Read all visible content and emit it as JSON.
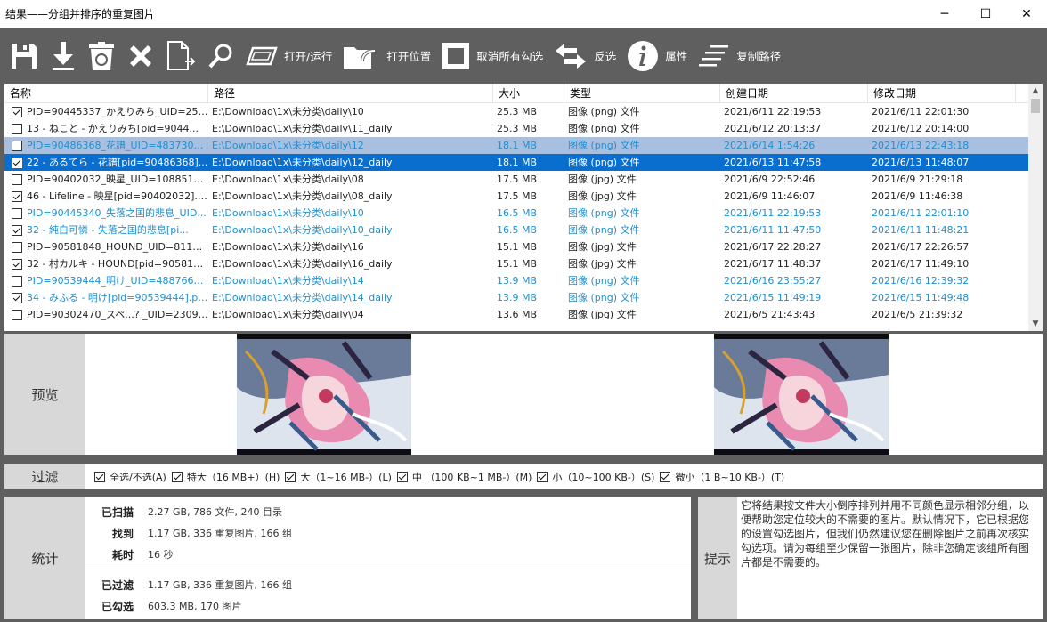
{
  "window": {
    "title": "结果——分组并排序的重复图片",
    "minimize": "─",
    "maximize": "☐",
    "close": "✕"
  },
  "toolbar": {
    "open_run_label": "打开/运行",
    "open_location_label": "打开位置",
    "uncheck_all_label": "取消所有勾选",
    "invert_label": "反选",
    "properties_label": "属性",
    "copy_path_label": "复制路径"
  },
  "table": {
    "headers": [
      "名称",
      "路径",
      "大小",
      "类型",
      "创建日期",
      "修改日期"
    ],
    "rows": [
      {
        "checked": true,
        "style": "normal",
        "name": "PID=90445337_かえりみち_UID=256...",
        "path": "E:\\Download\\1x\\未分类\\daily\\10",
        "size": "25.3 MB",
        "type": "图像 (png) 文件",
        "created": "2021/6/11 22:19:53",
        "modified": "2021/6/11 22:01:30"
      },
      {
        "checked": false,
        "style": "normal",
        "name": "13 - ねこと - かえりみち[pid=9044...",
        "path": "E:\\Download\\1x\\未分类\\daily\\11_daily",
        "size": "25.3 MB",
        "type": "图像 (png) 文件",
        "created": "2021/6/12 20:13:37",
        "modified": "2021/6/12 20:14:00"
      },
      {
        "checked": false,
        "style": "blue hl",
        "name": "PID=90486368_花譜_UID=483730_p0...",
        "path": "E:\\Download\\1x\\未分类\\daily\\12",
        "size": "18.1 MB",
        "type": "图像 (png) 文件",
        "created": "2021/6/14 1:54:26",
        "modified": "2021/6/13 22:43:18"
      },
      {
        "checked": true,
        "style": "sel",
        "name": "22 - あるてら - 花譜[pid=90486368]...",
        "path": "E:\\Download\\1x\\未分类\\daily\\12_daily",
        "size": "18.1 MB",
        "type": "图像 (png) 文件",
        "created": "2021/6/13 11:47:58",
        "modified": "2021/6/13 11:48:07"
      },
      {
        "checked": false,
        "style": "normal",
        "name": "PID=90402032_映星_UID=10885193_...",
        "path": "E:\\Download\\1x\\未分类\\daily\\08",
        "size": "17.5 MB",
        "type": "图像 (jpg) 文件",
        "created": "2021/6/9 22:52:46",
        "modified": "2021/6/9 21:29:18"
      },
      {
        "checked": true,
        "style": "normal",
        "name": "46 - Lifeline - 映星[pid=90402032].jpg",
        "path": "E:\\Download\\1x\\未分类\\daily\\08_daily",
        "size": "17.5 MB",
        "type": "图像 (jpg) 文件",
        "created": "2021/6/9 11:46:07",
        "modified": "2021/6/9 11:46:38"
      },
      {
        "checked": false,
        "style": "blue",
        "name": "PID=90445340_失落之国的悲息_UID...",
        "path": "E:\\Download\\1x\\未分类\\daily\\10",
        "size": "16.5 MB",
        "type": "图像 (png) 文件",
        "created": "2021/6/11 22:19:53",
        "modified": "2021/6/11 22:01:10"
      },
      {
        "checked": true,
        "style": "blue",
        "name": "32 - 純白可憐 - 失落之国的悲息[pi...",
        "path": "E:\\Download\\1x\\未分类\\daily\\10_daily",
        "size": "16.5 MB",
        "type": "图像 (png) 文件",
        "created": "2021/6/11 11:47:50",
        "modified": "2021/6/11 11:48:21"
      },
      {
        "checked": false,
        "style": "normal",
        "name": "PID=90581848_HOUND_UID=811927_...",
        "path": "E:\\Download\\1x\\未分类\\daily\\16",
        "size": "15.1 MB",
        "type": "图像 (jpg) 文件",
        "created": "2021/6/17 22:28:27",
        "modified": "2021/6/17 22:26:57"
      },
      {
        "checked": true,
        "style": "normal",
        "name": "32 - 村カルキ - HOUND[pid=905818...",
        "path": "E:\\Download\\1x\\未分类\\daily\\16_daily",
        "size": "15.1 MB",
        "type": "图像 (jpg) 文件",
        "created": "2021/6/17 11:48:37",
        "modified": "2021/6/17 11:49:10"
      },
      {
        "checked": false,
        "style": "blue",
        "name": "PID=90539444_明け_UID=488766_p0...",
        "path": "E:\\Download\\1x\\未分类\\daily\\14",
        "size": "13.9 MB",
        "type": "图像 (png) 文件",
        "created": "2021/6/16 23:55:27",
        "modified": "2021/6/16 12:39:32"
      },
      {
        "checked": true,
        "style": "blue",
        "name": "34 - みふる - 明け[pid=90539444].png",
        "path": "E:\\Download\\1x\\未分类\\daily\\14_daily",
        "size": "13.9 MB",
        "type": "图像 (png) 文件",
        "created": "2021/6/15 11:49:19",
        "modified": "2021/6/15 11:49:48"
      },
      {
        "checked": false,
        "style": "normal",
        "name": "PID=90302470_スペ...? _UID=230984...",
        "path": "E:\\Download\\1x\\未分类\\daily\\04",
        "size": "13.6 MB",
        "type": "图像 (jpg) 文件",
        "created": "2021/6/5 21:43:43",
        "modified": "2021/6/5 21:39:32"
      }
    ]
  },
  "preview": {
    "label": "预览"
  },
  "filter": {
    "label": "过滤",
    "options": [
      {
        "checked": true,
        "text": "全选/不选(A)"
      },
      {
        "checked": true,
        "text": "特大（16 MB+）(H)"
      },
      {
        "checked": true,
        "text": "大（1~16 MB-）(L)"
      },
      {
        "checked": true,
        "text": "中 （100 KB~1 MB-）(M)"
      },
      {
        "checked": true,
        "text": "小（10~100 KB-）(S)"
      },
      {
        "checked": true,
        "text": "微小（1 B~10 KB-）(T)"
      }
    ]
  },
  "stats": {
    "label": "统计",
    "scanned_key": "已扫描",
    "scanned_val": "2.27 GB, 786 文件, 240 目录",
    "found_key": "找到",
    "found_val": "1.17 GB, 336 重复图片, 166 组",
    "elapsed_key": "耗时",
    "elapsed_val": "16 秒",
    "filtered_key": "已过滤",
    "filtered_val": "1.17 GB, 336 重复图片, 166 组",
    "checked_key": "已勾选",
    "checked_val": "603.3 MB, 170 图片"
  },
  "tip": {
    "label": "提示",
    "text": "它将结果按文件大小倒序排列并用不同颜色显示相邻分组，以便帮助您定位较大的不需要的图片。默认情况下，它已根据您的设置勾选图片，但我们仍然建议您在删除图片之前再次核实勾选项。请为每组至少保留一张图片，除非您确定该组所有图片都是不需要的。"
  },
  "colors": {
    "toolbar_bg": "#5f5f5f",
    "selected_row": "#0a6ecf",
    "highlight_row": "#a8bfe0",
    "group_blue_text": "#1e90d0"
  }
}
